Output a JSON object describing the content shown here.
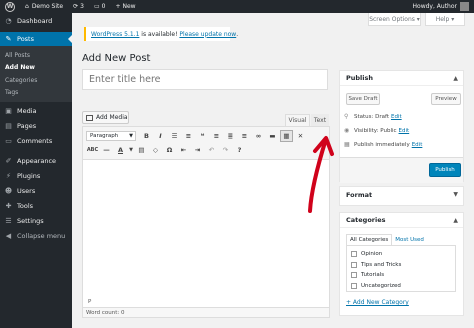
{
  "adminbar": {
    "site_name": "Demo Site",
    "updates_count": "3",
    "comments_count": "0",
    "new_label": "New",
    "greeting": "Howdy, Author"
  },
  "sidebar": {
    "items": [
      {
        "label": "Dashboard",
        "icon": "dashboard-icon"
      },
      {
        "label": "Posts",
        "icon": "pin-icon"
      },
      {
        "label": "Media",
        "icon": "media-icon"
      },
      {
        "label": "Pages",
        "icon": "pages-icon"
      },
      {
        "label": "Comments",
        "icon": "comments-icon"
      },
      {
        "label": "Appearance",
        "icon": "appearance-icon"
      },
      {
        "label": "Plugins",
        "icon": "plugins-icon"
      },
      {
        "label": "Users",
        "icon": "users-icon"
      },
      {
        "label": "Tools",
        "icon": "tools-icon"
      },
      {
        "label": "Settings",
        "icon": "settings-icon"
      },
      {
        "label": "Collapse menu",
        "icon": "collapse-icon"
      }
    ],
    "submenu": [
      "All Posts",
      "Add New",
      "Categories",
      "Tags"
    ]
  },
  "screen_options": "Screen Options ▾",
  "help": "Help ▾",
  "notice": {
    "text": "WordPress 5.1.1",
    "middle": " is available! ",
    "link": "Please update now",
    "end": "."
  },
  "page_title": "Add New Post",
  "title_placeholder": "Enter title here",
  "add_media": "Add Media",
  "editor_tabs": {
    "visual": "Visual",
    "text": "Text"
  },
  "toolbar": {
    "format_select": "Paragraph"
  },
  "path": "P",
  "word_count": "Word count: 0",
  "publish": {
    "title": "Publish",
    "save_draft": "Save Draft",
    "preview": "Preview",
    "status_label": "Status: Draft",
    "visibility_label": "Visibility: Public",
    "schedule_label": "Publish immediately",
    "edit": "Edit",
    "publish_button": "Publish"
  },
  "format": {
    "title": "Format"
  },
  "categories": {
    "title": "Categories",
    "tab_all": "All Categories",
    "tab_most_used": "Most Used",
    "items": [
      "Opinion",
      "Tips and Tricks",
      "Tutorials",
      "Uncategorized"
    ],
    "add_new": "+ Add New Category"
  },
  "colors": {
    "accent": "#0073aa",
    "adminbar": "#23282d",
    "arrow": "#d0021b"
  }
}
